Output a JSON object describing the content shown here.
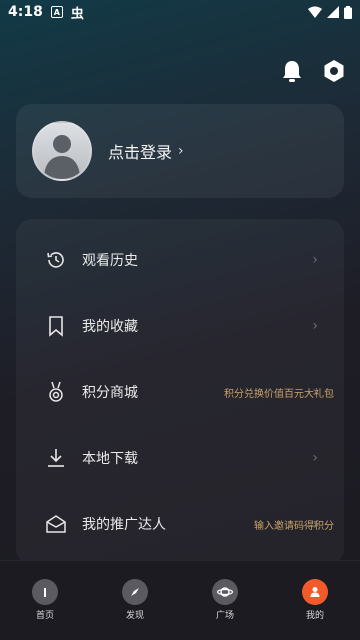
{
  "status_bar": {
    "time": "4:18",
    "a_label": "A",
    "bug_glyph": "虫"
  },
  "header": {
    "bell_icon": "bell-icon",
    "settings_icon": "settings-icon"
  },
  "login": {
    "label": "点击登录",
    "chevron": "›"
  },
  "menu": [
    {
      "label": "观看历史",
      "hint": "",
      "icon": "history-icon"
    },
    {
      "label": "我的收藏",
      "hint": "",
      "icon": "bookmark-icon"
    },
    {
      "label": "积分商城",
      "hint": "积分兑换价值百元大礼包",
      "icon": "medal-icon"
    },
    {
      "label": "本地下载",
      "hint": "",
      "icon": "download-icon"
    },
    {
      "label": "我的推广达人",
      "hint": "输入邀请码得积分",
      "icon": "mail-icon"
    }
  ],
  "menu_chevron": "›",
  "bottom_nav": [
    {
      "label": "首页",
      "active": false
    },
    {
      "label": "发现",
      "active": false
    },
    {
      "label": "广场",
      "active": false
    },
    {
      "label": "我的",
      "active": true
    }
  ],
  "colors": {
    "accent": "#f25a2b",
    "hint": "#c9a36a"
  }
}
